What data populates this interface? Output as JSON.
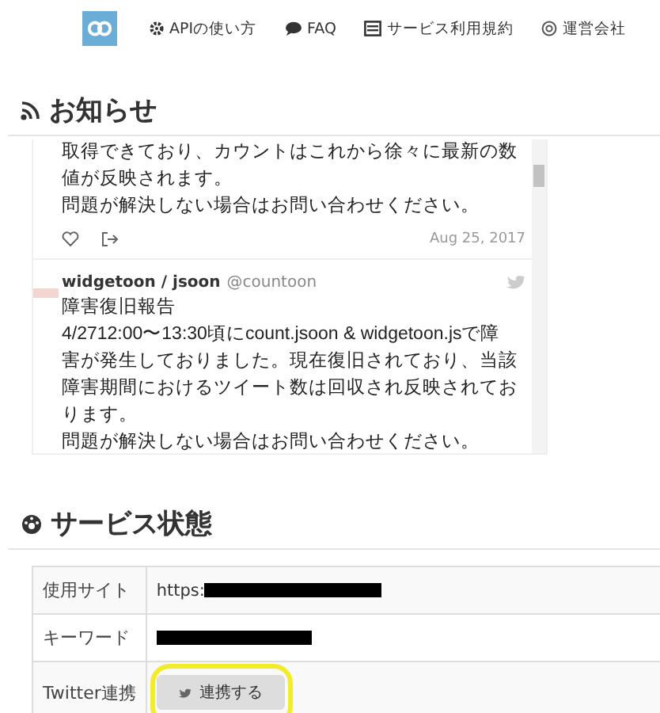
{
  "nav": {
    "items": [
      {
        "label": "APIの使い方"
      },
      {
        "label": "FAQ"
      },
      {
        "label": "サービス利用規約"
      },
      {
        "label": "運営会社"
      }
    ]
  },
  "news": {
    "title": "お知らせ",
    "tweets": [
      {
        "kind": "partial",
        "lines": [
          "取得できており、カウントはこれから徐々に最新の数",
          "値が反映されます。",
          "問題が解決しない場合はお問い合わせください。"
        ],
        "date": "Aug 25, 2017"
      },
      {
        "kind": "full",
        "author": "widgetoon / jsoon",
        "handle": "@countoon",
        "lines": [
          "障害復旧報告",
          "4/2712:00〜13:30頃にcount.jsoon & widgetoon.jsで障",
          "害が発生しておりました。現在復旧されており、当該",
          "障害期間におけるツイート数は回収され反映されてお",
          "ります。",
          "問題が解決しない場合はお問い合わせください。"
        ]
      }
    ]
  },
  "status": {
    "title": "サービス状態",
    "rows": [
      {
        "label": "使用サイト",
        "kind": "redacted_text",
        "value": "https:"
      },
      {
        "label": "キーワード",
        "kind": "redacted"
      },
      {
        "label": "Twitter連携",
        "kind": "button",
        "button": "連携する"
      }
    ]
  }
}
